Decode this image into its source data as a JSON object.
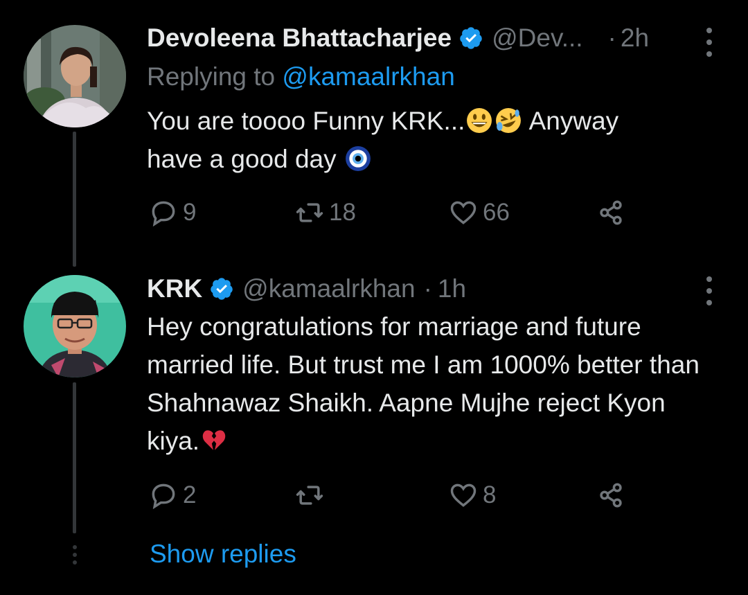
{
  "tweets": [
    {
      "display_name": "Devoleena Bhattacharjee",
      "handle": "@Dev...",
      "separator": "·",
      "time": "2h",
      "replying_prefix": "Replying to ",
      "replying_to": "@kamaalrkhan",
      "text_line1": "You are toooo Funny KRK...",
      "text_line1_after": " Anyway",
      "text_line2": "have a good day ",
      "emojis": [
        "grinning-face",
        "rolling-on-floor-laughing",
        "nazar-amulet"
      ],
      "replies": "9",
      "retweets": "18",
      "likes": "66"
    },
    {
      "display_name": "KRK",
      "handle": "@kamaalrkhan",
      "separator": "·",
      "time": "1h",
      "text": "Hey congratulations for marriage and future married life. But trust me I am 1000% better than Shahnawaz Shaikh. Aapne Mujhe reject Kyon kiya.",
      "emojis": [
        "broken-heart"
      ],
      "replies": "2",
      "retweets": "",
      "likes": "8"
    }
  ],
  "show_replies_label": "Show replies",
  "colors": {
    "background": "#000000",
    "primary_text": "#e7e9ea",
    "secondary_text": "#71767b",
    "accent": "#1d9bf0",
    "thread_line": "#333639"
  }
}
